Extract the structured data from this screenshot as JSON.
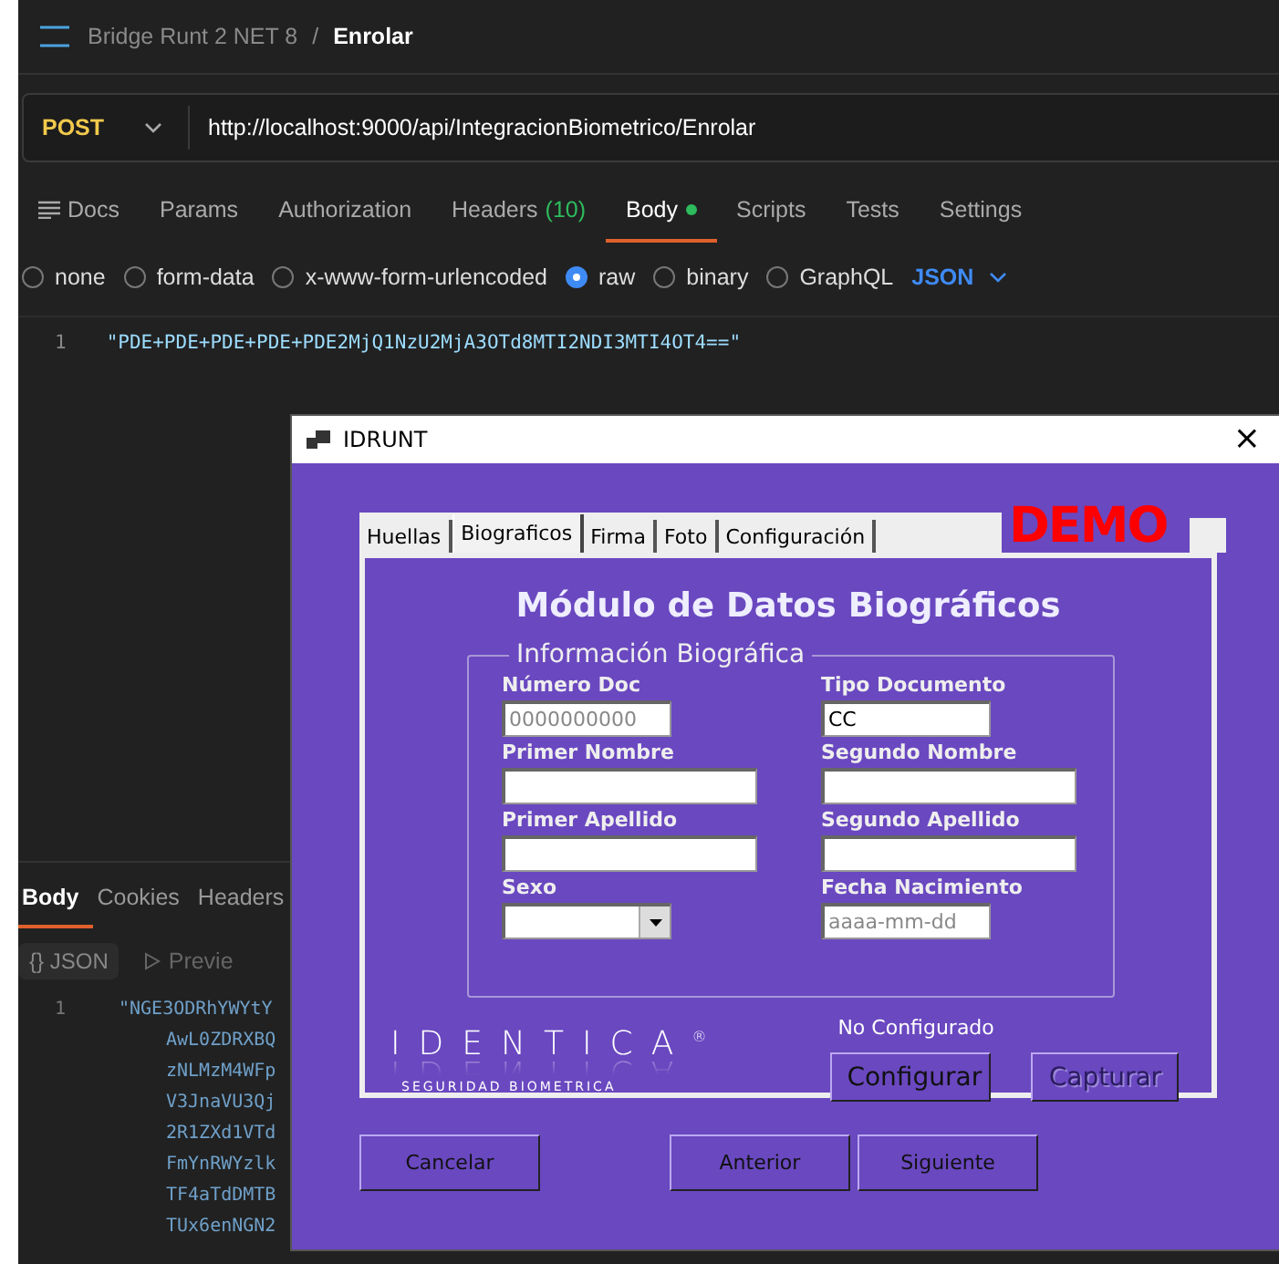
{
  "breadcrumb": {
    "collection": "Bridge Runt 2 NET 8",
    "separator": "/",
    "request": "Enrolar"
  },
  "request": {
    "method": "POST",
    "url": "http://localhost:9000/api/IntegracionBiometrico/Enrolar"
  },
  "tabs": [
    {
      "label": "Docs",
      "selected": false,
      "kind": "docs"
    },
    {
      "label": "Params",
      "selected": false
    },
    {
      "label": "Authorization",
      "selected": false
    },
    {
      "label": "Headers",
      "count": "(10)",
      "selected": false
    },
    {
      "label": "Body",
      "selected": true,
      "kind": "dot"
    },
    {
      "label": "Scripts",
      "selected": false
    },
    {
      "label": "Tests",
      "selected": false
    },
    {
      "label": "Settings",
      "selected": false
    }
  ],
  "body_types": [
    {
      "label": "none",
      "selected": false
    },
    {
      "label": "form-data",
      "selected": false
    },
    {
      "label": "x-www-form-urlencoded",
      "selected": false
    },
    {
      "label": "raw",
      "selected": true
    },
    {
      "label": "binary",
      "selected": false
    },
    {
      "label": "GraphQL",
      "selected": false
    }
  ],
  "body_format": "JSON",
  "editor": {
    "line_number": "1",
    "code": "\"PDE+PDE+PDE+PDE+PDE2MjQ1NzU2MjA3OTd8MTI2NDI3MTI4OT4==\""
  },
  "response": {
    "tabs": [
      {
        "label": "Body",
        "selected": true
      },
      {
        "label": "Cookies",
        "selected": false
      },
      {
        "label": "Headers",
        "selected": false
      }
    ],
    "format": "{} JSON",
    "preview": "Previe",
    "line_number": "1",
    "lines": [
      "\"NGE3ODRhYWYtY",
      "AwL0ZDRXBQ",
      "zNLMzM4WFp",
      "V3JnaVU3Qj",
      "2R1ZXd1VTd",
      "FmYnRWYzlk",
      "TF4aTdDMTB",
      "TUx6enNGN2"
    ]
  },
  "dialog": {
    "title": "IDRUNT",
    "close": "×",
    "tabs": [
      {
        "label": "Huellas",
        "selected": false
      },
      {
        "label": "Biograficos",
        "selected": true
      },
      {
        "label": "Firma",
        "selected": false
      },
      {
        "label": "Foto",
        "selected": false
      },
      {
        "label": "Configuración",
        "selected": false
      }
    ],
    "badge": "DEMO",
    "heading": "Módulo de Datos Biográficos",
    "group_title": "Información Biográfica",
    "fields": [
      {
        "label": "Número Doc",
        "placeholder": "0000000000",
        "kind": "text"
      },
      {
        "label": "Tipo Documento",
        "value": "CC",
        "kind": "text"
      },
      {
        "label": "Primer Nombre",
        "kind": "text"
      },
      {
        "label": "Segundo Nombre",
        "kind": "text"
      },
      {
        "label": "Primer Apellido",
        "kind": "text"
      },
      {
        "label": "Segundo Apellido",
        "kind": "text"
      },
      {
        "label": "Sexo",
        "kind": "select"
      },
      {
        "label": "Fecha Nacimiento",
        "placeholder": "aaaa-mm-dd",
        "kind": "text"
      }
    ],
    "logo": {
      "name": "IDENTICA$^{®}$",
      "tagline": "SEGURIDAD BIOMETRICA"
    },
    "status": "No Configurado",
    "actions": [
      {
        "label": "Configurar",
        "disabled": false
      },
      {
        "label": "Capturar",
        "disabled": true
      }
    ],
    "buttons": [
      {
        "label": "Cancelar"
      },
      {
        "label": "Anterior"
      },
      {
        "label": "Siguiente"
      }
    ]
  }
}
